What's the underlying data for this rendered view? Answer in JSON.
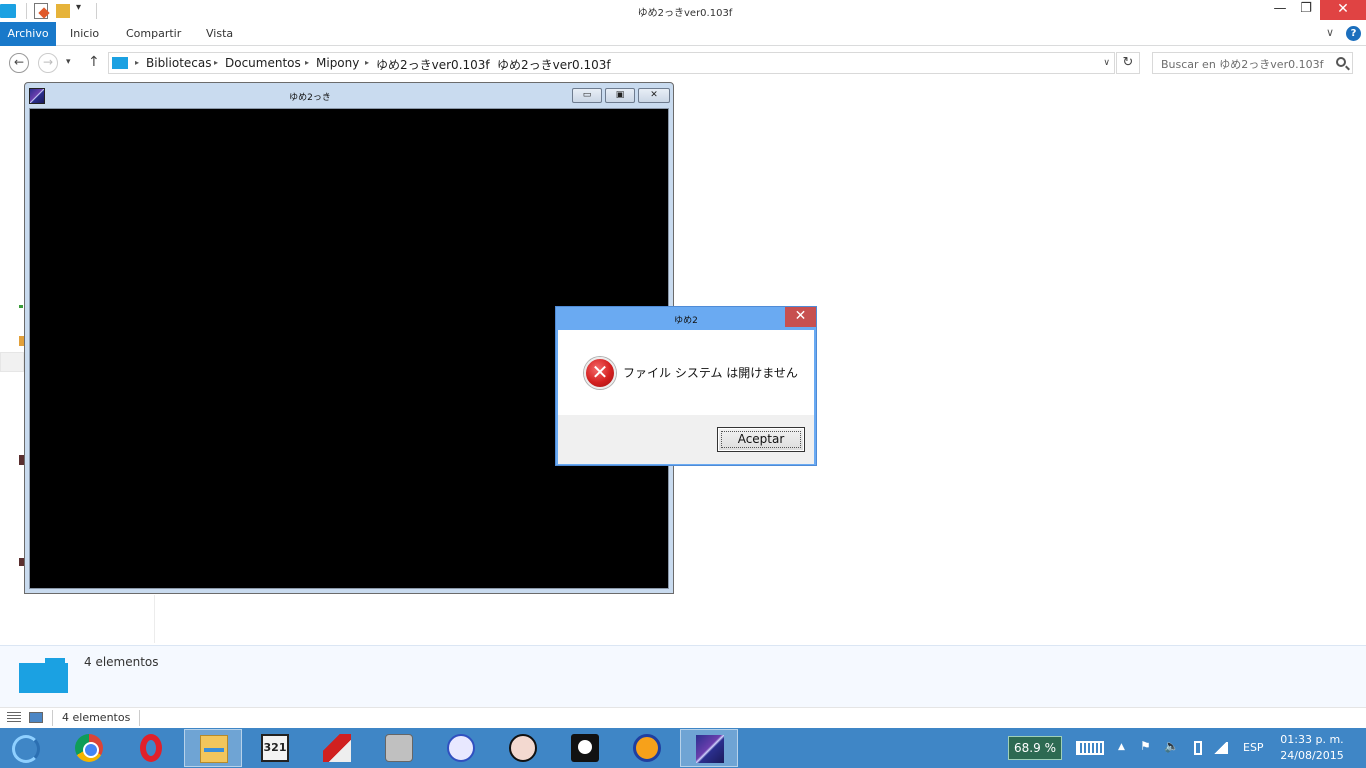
{
  "explorer": {
    "window_title": "ゆめ2っきver0.103f",
    "minimize_glyph": "—",
    "maximize_glyph": "❐",
    "close_glyph": "✕",
    "qat_dropdown_glyph": "▾",
    "tabs": [
      {
        "label": "Archivo"
      },
      {
        "label": "Inicio"
      },
      {
        "label": "Compartir"
      },
      {
        "label": "Vista"
      }
    ],
    "ribbon_expand_glyph": "∨",
    "help_glyph": "?",
    "nav": {
      "back_glyph": "←",
      "forward_glyph": "→",
      "recent_glyph": "▾",
      "up_glyph": "↑",
      "refresh_glyph": "↻",
      "dropdown_glyph": "∨",
      "breadcrumbs": [
        "Bibliotecas",
        "Documentos",
        "Mipony",
        "ゆめ2っきver0.103f",
        "ゆめ2っきver0.103f"
      ],
      "crumb_sep": "▸"
    },
    "search": {
      "placeholder": "Buscar en ゆめ2っきver0.103f"
    },
    "details": {
      "count": "4 elementos"
    },
    "status": {
      "count": "4 elementos"
    }
  },
  "game_window": {
    "title": "ゆめ2っき",
    "minimize_glyph": "▭",
    "maximize_glyph": "▣",
    "close_glyph": "✕"
  },
  "dialog": {
    "title": "ゆめ2",
    "close_glyph": "✕",
    "error_glyph": "✕",
    "message": "ファイル システム は開けません",
    "ok_label": "Aceptar"
  },
  "taskbar": {
    "mpc_label": "321",
    "battery": "68.9 %",
    "tray_up": "▲",
    "flag_glyph": "⚑",
    "sound_glyph": "🔈",
    "language": "ESP",
    "time": "01:33 p. m.",
    "date": "24/08/2015"
  },
  "colors": {
    "accent": "#1979ca",
    "taskbar": "#3f86c6",
    "dialog_frame": "#6aaaf2",
    "close_red": "#c75050"
  }
}
